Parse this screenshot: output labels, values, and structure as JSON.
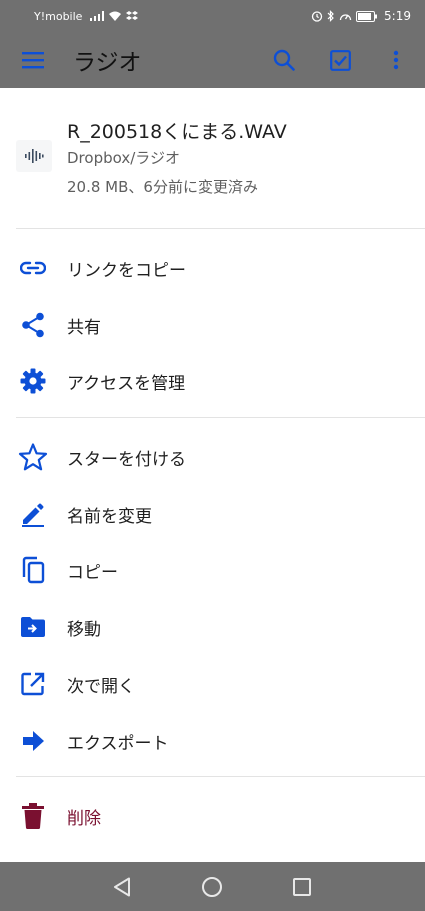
{
  "status_bar": {
    "carrier": "Y!mobile",
    "time": "5:19"
  },
  "app_bar": {
    "title": "ラジオ",
    "icons": [
      "menu-icon",
      "search-icon",
      "select-icon",
      "more-vert-icon"
    ]
  },
  "file": {
    "name": "R_200518くにまる.WAV",
    "path": "Dropbox/ラジオ",
    "meta": "20.8 MB、6分前に変更済み"
  },
  "menu": {
    "copy_link": "リンクをコピー",
    "share": "共有",
    "manage_access": "アクセスを管理",
    "star": "スターを付ける",
    "rename": "名前を変更",
    "copy": "コピー",
    "move": "移動",
    "open_with": "次で開く",
    "export": "エクスポート",
    "delete": "削除"
  },
  "colors": {
    "accent": "#0d4fd6",
    "danger": "#7a1030",
    "bar": "#707070"
  }
}
